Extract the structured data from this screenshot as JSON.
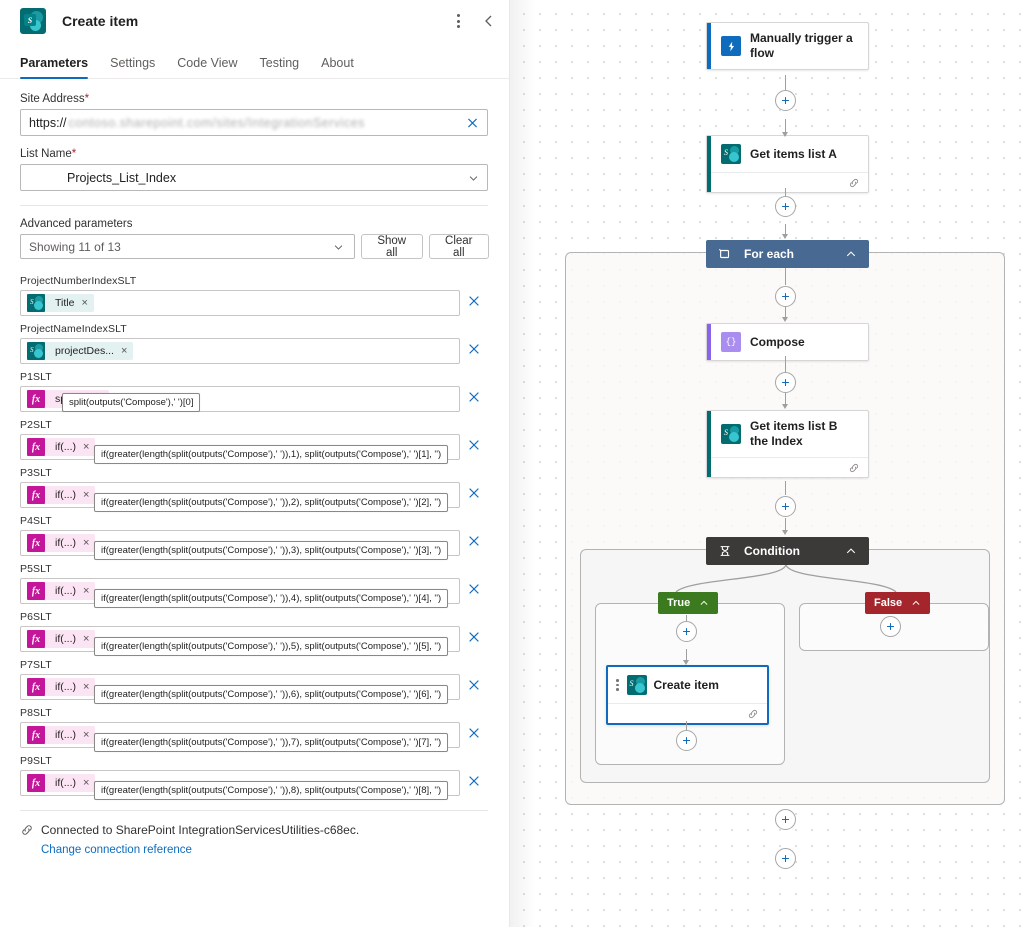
{
  "panel": {
    "title": "Create item",
    "icon": "sharepoint-icon",
    "menu_icon": "more-vertical-icon",
    "collapse_icon": "chevron-left-icon",
    "tabs": [
      {
        "label": "Parameters",
        "active": true
      },
      {
        "label": "Settings",
        "active": false
      },
      {
        "label": "Code View",
        "active": false
      },
      {
        "label": "Testing",
        "active": false
      },
      {
        "label": "About",
        "active": false
      }
    ],
    "fields": {
      "site_address": {
        "label": "Site Address",
        "required": "*",
        "value_prefix": "https://",
        "value_redacted": "contoso.sharepoint.com/sites/IntegrationServices",
        "clear_icon": "close-icon"
      },
      "list_name": {
        "label": "List Name",
        "required": "*",
        "value": "Projects_List_Index",
        "dropdown_icon": "chevron-down-icon"
      }
    },
    "advanced": {
      "label": "Advanced parameters",
      "showing": "Showing 11 of 13",
      "dropdown_icon": "chevron-down-icon",
      "show_all": "Show all",
      "clear_all": "Clear all"
    },
    "parameters": [
      {
        "label": "ProjectNumberIndexSLT",
        "chip_type": "sp",
        "chip_text": "Title",
        "tooltip": null
      },
      {
        "label": "ProjectNameIndexSLT",
        "chip_type": "sp",
        "chip_text": "projectDes...",
        "tooltip": null
      },
      {
        "label": "P1SLT",
        "chip_type": "fx",
        "chip_text": "split(...)",
        "tooltip": "split(outputs('Compose'),' ')[0]"
      },
      {
        "label": "P2SLT",
        "chip_type": "fx",
        "chip_text": "if(...)",
        "tooltip": "if(greater(length(split(outputs('Compose'),' ')),1), split(outputs('Compose'),' ')[1], '')"
      },
      {
        "label": "P3SLT",
        "chip_type": "fx",
        "chip_text": "if(...)",
        "tooltip": "if(greater(length(split(outputs('Compose'),' ')),2), split(outputs('Compose'),' ')[2], '')"
      },
      {
        "label": "P4SLT",
        "chip_type": "fx",
        "chip_text": "if(...)",
        "tooltip": "if(greater(length(split(outputs('Compose'),' ')),3), split(outputs('Compose'),' ')[3], '')"
      },
      {
        "label": "P5SLT",
        "chip_type": "fx",
        "chip_text": "if(...)",
        "tooltip": "if(greater(length(split(outputs('Compose'),' ')),4), split(outputs('Compose'),' ')[4], '')"
      },
      {
        "label": "P6SLT",
        "chip_type": "fx",
        "chip_text": "if(...)",
        "tooltip": "if(greater(length(split(outputs('Compose'),' ')),5), split(outputs('Compose'),' ')[5], '')"
      },
      {
        "label": "P7SLT",
        "chip_type": "fx",
        "chip_text": "if(...)",
        "tooltip": "if(greater(length(split(outputs('Compose'),' ')),6), split(outputs('Compose'),' ')[6], '')"
      },
      {
        "label": "P8SLT",
        "chip_type": "fx",
        "chip_text": "if(...)",
        "tooltip": "if(greater(length(split(outputs('Compose'),' ')),7), split(outputs('Compose'),' ')[7], '')"
      },
      {
        "label": "P9SLT",
        "chip_type": "fx",
        "chip_text": "if(...)",
        "tooltip": "if(greater(length(split(outputs('Compose'),' ')),8), split(outputs('Compose'),' ')[8], '')"
      }
    ],
    "footer": {
      "connection_icon": "link-icon",
      "connection_text": "Connected to SharePoint IntegrationServicesUtilities-c68ec.",
      "change_link": "Change connection reference"
    },
    "chip_remove_icon": "close-small-icon",
    "row_remove_icon": "close-icon"
  },
  "canvas": {
    "add_icon": "plus-icon",
    "nodes": {
      "trigger": {
        "title": "Manually trigger a flow",
        "icon": "flow-trigger-icon",
        "accent": "#0f6cbd"
      },
      "get_items_a": {
        "title": "Get items list A",
        "icon": "sharepoint-icon",
        "accent": "#036c70",
        "footer_icon": "link-icon"
      },
      "for_each": {
        "title": "For each",
        "icon": "foreach-icon",
        "caret_icon": "chevron-up-icon",
        "color": "#486992"
      },
      "compose": {
        "title": "Compose",
        "icon": "compose-icon",
        "accent": "#8a64e8"
      },
      "get_items_b": {
        "title": "Get items list B the Index",
        "icon": "sharepoint-icon",
        "accent": "#036c70",
        "footer_icon": "link-icon"
      },
      "condition": {
        "title": "Condition",
        "icon": "condition-icon",
        "caret_icon": "chevron-up-icon",
        "color": "#3b3a39"
      },
      "branch_true": {
        "label": "True",
        "caret_icon": "chevron-up-icon",
        "color": "#3b7a1e"
      },
      "branch_false": {
        "label": "False",
        "caret_icon": "chevron-up-icon",
        "color": "#a4262c"
      },
      "create_item": {
        "title": "Create item",
        "icon": "sharepoint-icon",
        "accent": "#036c70",
        "footer_icon": "link-icon",
        "selected": true,
        "grip_icon": "drag-handle-icon"
      }
    }
  }
}
